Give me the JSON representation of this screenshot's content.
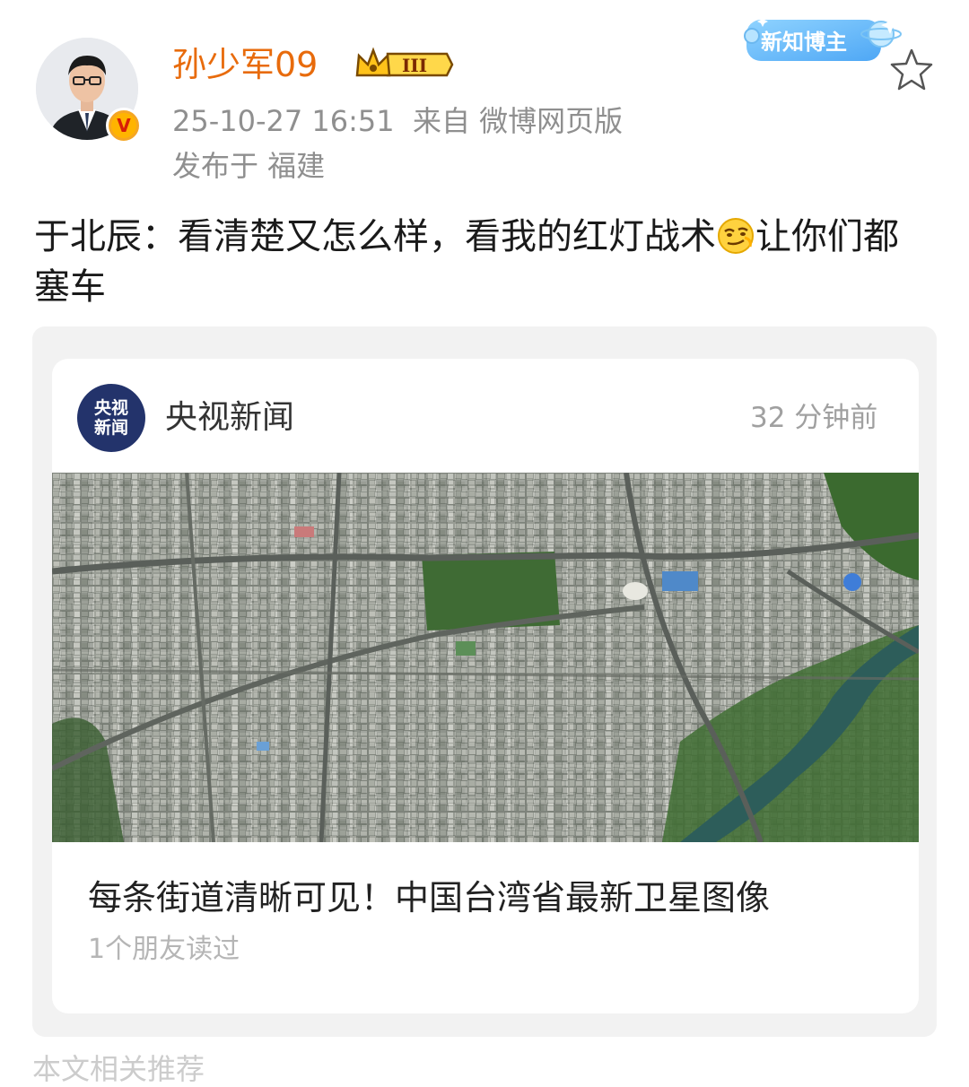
{
  "header": {
    "username": "孙少军09",
    "member_level": "III",
    "date": "25-10-27 16:51",
    "source": "来自 微博网页版",
    "location": "发布于 福建",
    "new_blogger_badge": "新知博主",
    "verified_mark": "V",
    "avatar_icon": "avatar-person-icon",
    "favorite_icon": "star-outline-icon"
  },
  "post": {
    "text_before": "于北辰：看清楚又怎么样，看我的红灯战术",
    "emoji_name": "smirk-emoji-icon",
    "text_after": "让你们都塞车"
  },
  "card": {
    "logo_line1": "央视",
    "logo_line2": "新闻",
    "source_name": "央视新闻",
    "time": "32 分钟前",
    "headline": "每条街道清晰可见！中国台湾省最新卫星图像",
    "readers": "1个朋友读过",
    "image_icon": "satellite-map-image"
  },
  "colors": {
    "username": "#e86b0c",
    "meta": "#8f8f8f",
    "card_bg": "#f2f2f2",
    "logo_bg": "#23336b"
  },
  "footer_partial": "本文相关推荐"
}
